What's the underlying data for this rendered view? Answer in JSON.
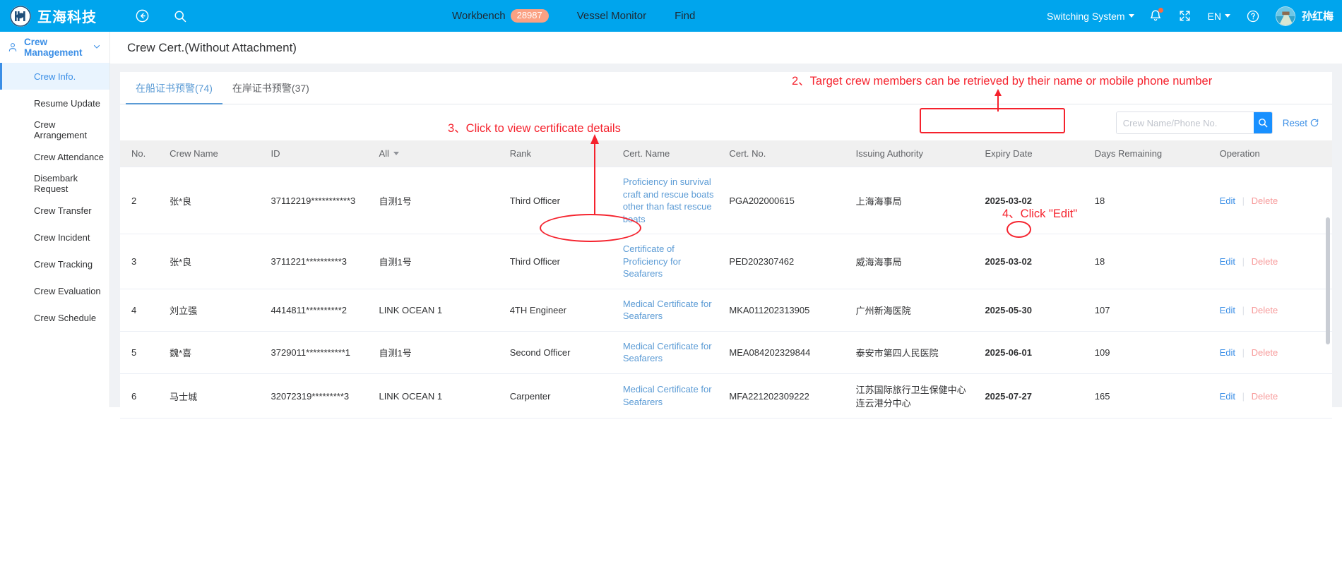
{
  "topnav": {
    "brand_name": "互海科技",
    "back_icon": "back-arrow-icon",
    "search_icon": "search-icon",
    "items": [
      {
        "label": "Workbench",
        "badge": "28987"
      },
      {
        "label": "Vessel Monitor",
        "badge": ""
      },
      {
        "label": "Find",
        "badge": ""
      }
    ],
    "switch_system": "Switching System",
    "language": "EN",
    "username": "孙红梅",
    "badge_color": "#fba183",
    "bar_color": "#00a5ed"
  },
  "sidebar": {
    "group_label": "Crew Management",
    "items": [
      {
        "label": "Crew Info.",
        "active": true
      },
      {
        "label": "Resume Update",
        "active": false
      },
      {
        "label": "Crew Arrangement",
        "active": false
      },
      {
        "label": "Crew Attendance",
        "active": false
      },
      {
        "label": "Disembark Request",
        "active": false
      },
      {
        "label": "Crew Transfer",
        "active": false
      },
      {
        "label": "Crew Incident",
        "active": false
      },
      {
        "label": "Crew Tracking",
        "active": false
      },
      {
        "label": "Crew Evaluation",
        "active": false
      },
      {
        "label": "Crew Schedule",
        "active": false
      }
    ]
  },
  "page": {
    "title": "Crew Cert.(Without Attachment)",
    "tabs": [
      {
        "label": "在船证书预警(74)",
        "active": true
      },
      {
        "label": "在岸证书预警(37)",
        "active": false
      }
    ]
  },
  "search": {
    "value": "",
    "placeholder": "Crew Name/Phone No.",
    "button_icon": "search-icon",
    "reset_label": "Reset",
    "reset_icon": "refresh-icon"
  },
  "table": {
    "columns": [
      "No.",
      "Crew Name",
      "ID",
      "All",
      "Rank",
      "Cert. Name",
      "Cert. No.",
      "Issuing Authority",
      "Expiry Date",
      "Days Remaining",
      "Operation"
    ],
    "filter_column_label": "All",
    "rows": [
      {
        "no": "2",
        "crew_name": "张*良",
        "id": "37112219***********3",
        "all": "自测1号",
        "rank": "Third Officer",
        "cert_name": "Proficiency in survival craft and rescue boats other than fast rescue boats",
        "cert_no": "PGA202000615",
        "authority": "上海海事局",
        "expiry": "2025-03-02",
        "days": "18",
        "edit": "Edit",
        "delete": "Delete"
      },
      {
        "no": "3",
        "crew_name": "张*良",
        "id": "3711221**********3",
        "all": "自测1号",
        "rank": "Third Officer",
        "cert_name": "Certificate of Proficiency for Seafarers",
        "cert_no": "PED202307462",
        "authority": "威海海事局",
        "expiry": "2025-03-02",
        "days": "18",
        "edit": "Edit",
        "delete": "Delete"
      },
      {
        "no": "4",
        "crew_name": "刘立强",
        "id": "4414811**********2",
        "all": "LINK OCEAN 1",
        "rank": "4TH Engineer",
        "cert_name": "Medical Certificate for Seafarers",
        "cert_no": "MKA011202313905",
        "authority": "广州新海医院",
        "expiry": "2025-05-30",
        "days": "107",
        "edit": "Edit",
        "delete": "Delete"
      },
      {
        "no": "5",
        "crew_name": "魏*喜",
        "id": "3729011***********1",
        "all": "自测1号",
        "rank": "Second Officer",
        "cert_name": "Medical Certificate for Seafarers",
        "cert_no": "MEA084202329844",
        "authority": "泰安市第四人民医院",
        "expiry": "2025-06-01",
        "days": "109",
        "edit": "Edit",
        "delete": "Delete"
      },
      {
        "no": "6",
        "crew_name": "马士城",
        "id": "32072319*********3",
        "all": "LINK OCEAN 1",
        "rank": "Carpenter",
        "cert_name": "Medical Certificate for Seafarers",
        "cert_no": "MFA221202309222",
        "authority": "江苏国际旅行卫生保健中心连云港分中心",
        "expiry": "2025-07-27",
        "days": "165",
        "edit": "Edit",
        "delete": "Delete"
      }
    ]
  },
  "annotations": {
    "color": "#f5222d",
    "note2": "2、Target crew members can be retrieved by their name or mobile phone number",
    "note3": "3、Click to view certificate details",
    "note4": "4、Click \"Edit\""
  }
}
